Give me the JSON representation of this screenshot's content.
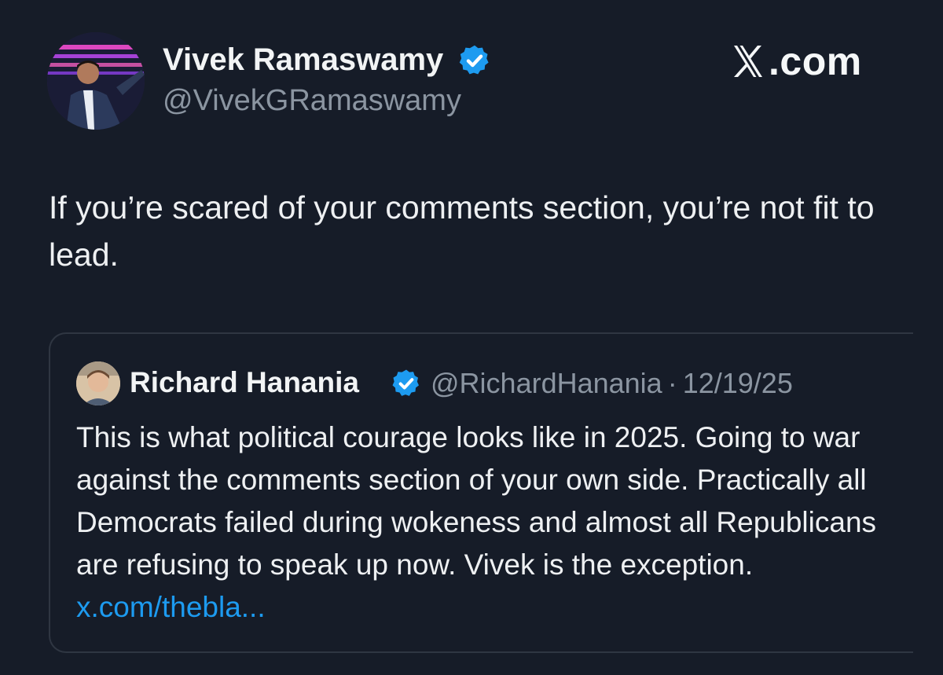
{
  "author": {
    "display_name": "Vivek Ramaswamy",
    "handle": "@VivekGRamaswamy",
    "verified": true,
    "avatar_icon": "profile-photo"
  },
  "brand": {
    "text": ".com",
    "icon": "x-logo-icon"
  },
  "tweet": {
    "text": "If you’re scared of your comments section, you’re not fit to lead."
  },
  "quoted_tweet": {
    "display_name": "Richard Hanania",
    "handle": "@RichardHanania",
    "separator": "·",
    "date": "12/19/25",
    "verified": true,
    "text": "This is what political courage looks like in 2025. Going to war against the comments section of your own side. Practically all Democrats failed during wokeness and almost all Republicans are refusing to speak up now. Vivek is the exception.",
    "link": "x.com/thebla..."
  },
  "colors": {
    "background": "#161c28",
    "text": "#e7e9ea",
    "muted": "#8b95a1",
    "verified_badge": "#1d9bf0",
    "link": "#1d9bf0",
    "card_border": "#2f3642"
  }
}
